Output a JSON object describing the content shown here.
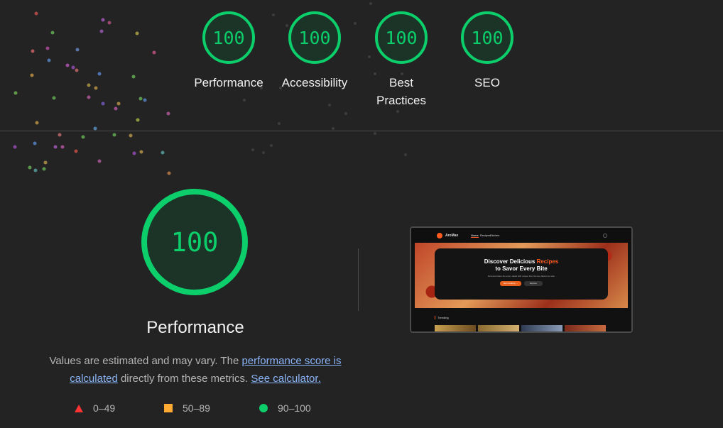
{
  "colors": {
    "pass": "#0cce6b",
    "average": "#ffaa33",
    "fail": "#ff3333",
    "link": "#8ab4f8"
  },
  "top_gauges": [
    {
      "score": "100",
      "label": "Performance"
    },
    {
      "score": "100",
      "label": "Accessibility"
    },
    {
      "score": "100",
      "label": "Best Practices"
    },
    {
      "score": "100",
      "label": "SEO"
    }
  ],
  "performance": {
    "score": "100",
    "title": "Performance",
    "note_prefix": "Values are estimated and may vary. The ",
    "note_link1": "performance score is calculated",
    "note_mid": " directly from these metrics. ",
    "note_link2": "See calculator."
  },
  "legend": [
    {
      "icon": "triangle-icon",
      "range": "0–49"
    },
    {
      "icon": "square-icon",
      "range": "50–89"
    },
    {
      "icon": "circle-icon",
      "range": "90–100"
    }
  ],
  "screenshot": {
    "brand": "AroMax",
    "nav": [
      "Home",
      "Recipes",
      "Kitchen"
    ],
    "hero_line1_prefix": "Discover Delicious ",
    "hero_line1_accent": "Recipes",
    "hero_line2": "to Savor Every Bite",
    "hero_sub": "Find and share the every detail with unique then the key flavors to refer",
    "btn_primary": "Get Cooking →",
    "btn_secondary": "Explore",
    "trending": "Trending"
  }
}
